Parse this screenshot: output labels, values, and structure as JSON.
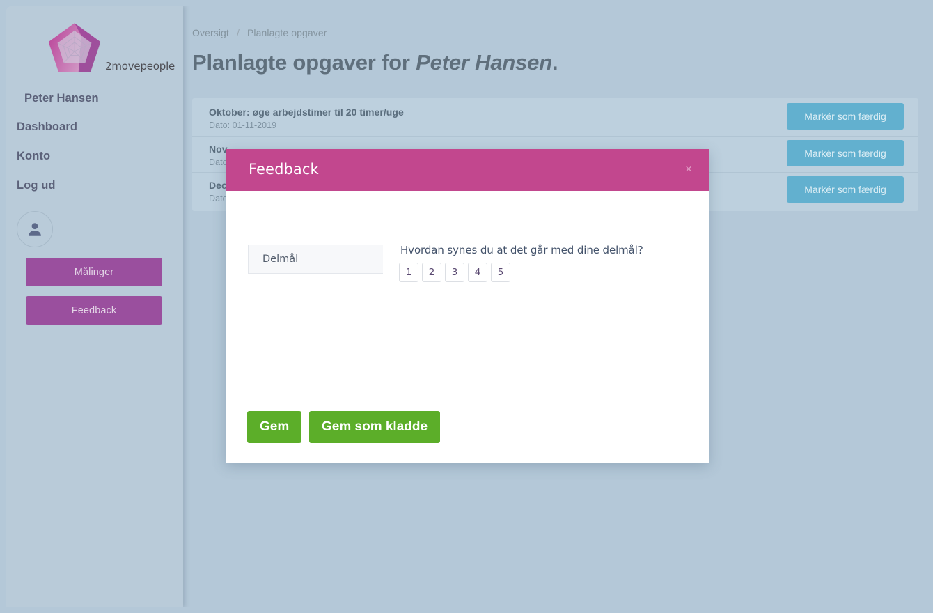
{
  "sidebar": {
    "logo": {
      "icon": "pentagon-radar-logo-icon",
      "wordmark": "2movepeople"
    },
    "user_name": "Peter Hansen",
    "nav_items": [
      {
        "label": "Dashboard"
      },
      {
        "label": "Konto"
      },
      {
        "label": "Log ud"
      }
    ],
    "avatar_icon": "user-silhouette-icon",
    "action_buttons": [
      {
        "label": "Målinger"
      },
      {
        "label": "Feedback"
      }
    ],
    "colors": {
      "background": "#b9cbd9",
      "button": "#9a4f9e",
      "text": "#5b6179"
    }
  },
  "main": {
    "breadcrumb": {
      "root": "Oversigt",
      "separator": "/",
      "current": "Planlagte opgaver"
    },
    "page_title_prefix": "Planlagte opgaver for ",
    "page_title_name": "Peter Hansen",
    "page_title_suffix": ".",
    "tasks": [
      {
        "title": "Oktober: øge arbejdstimer til 20 timer/uge",
        "date": "Dato: 01-11-2019",
        "action": "Markér som færdig"
      },
      {
        "title": "Nov",
        "date": "Dato",
        "action": "Markér som færdig"
      },
      {
        "title": "Dec",
        "date": "Dato",
        "action": "Markér som færdig"
      }
    ],
    "colors": {
      "panel": "#bdd0de",
      "task_button": "#62b0cf",
      "title": "#5f6f7c"
    }
  },
  "modal": {
    "title": "Feedback",
    "close_label": "×",
    "field_label": "Delmål",
    "question": "Hvordan synes du at det går med dine delmål?",
    "rating_options": [
      "1",
      "2",
      "3",
      "4",
      "5"
    ],
    "footer_buttons": [
      {
        "label": "Gem"
      },
      {
        "label": "Gem som kladde"
      }
    ],
    "colors": {
      "header": "#c2478e",
      "body": "#ffffff",
      "save_button": "#5cae29"
    }
  }
}
